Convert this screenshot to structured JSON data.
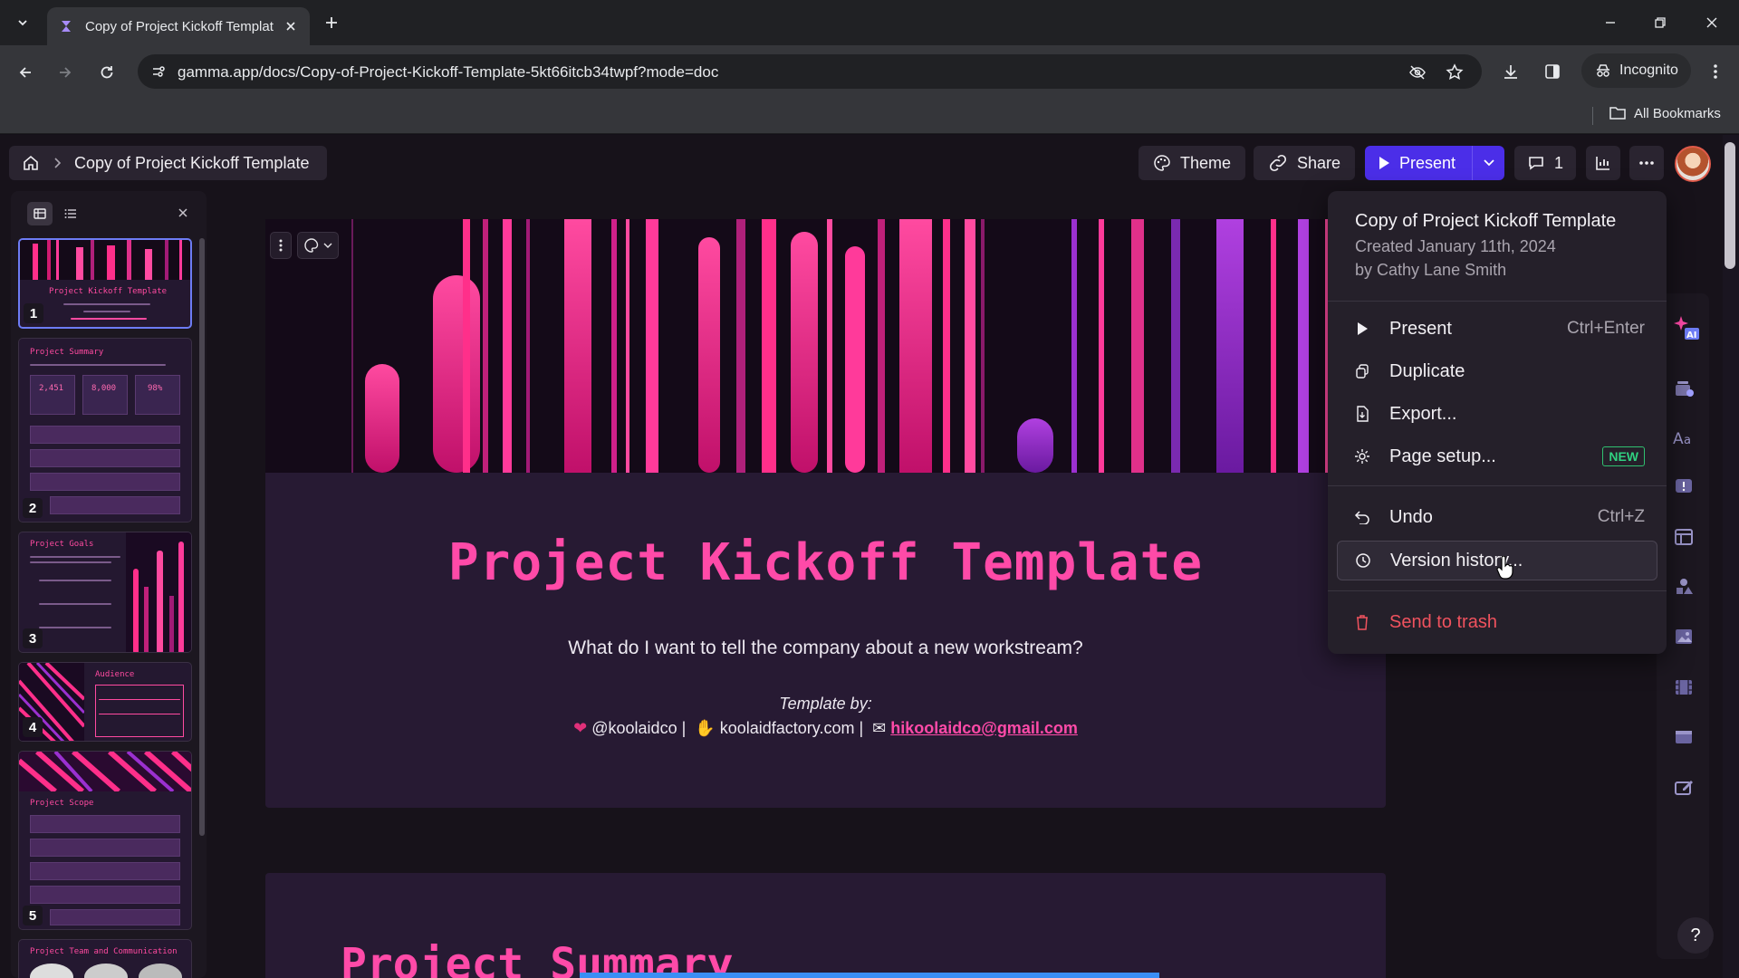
{
  "browser": {
    "tab_title": "Copy of Project Kickoff Templat",
    "url": "gamma.app/docs/Copy-of-Project-Kickoff-Template-5kt66itcb34twpf?mode=doc",
    "incognito_label": "Incognito",
    "bookmarks_label": "All Bookmarks"
  },
  "header": {
    "breadcrumb_title": "Copy of Project Kickoff Template",
    "theme_label": "Theme",
    "share_label": "Share",
    "present_label": "Present",
    "comments_count": "1"
  },
  "sidebar": {
    "thumbnails": [
      {
        "num": "1",
        "title": "Project Kickoff Template"
      },
      {
        "num": "2",
        "title": "Project Summary",
        "stats": [
          "2,451",
          "8,000",
          "98%"
        ]
      },
      {
        "num": "3",
        "title": "Project Goals"
      },
      {
        "num": "4",
        "title": "Audience"
      },
      {
        "num": "5",
        "title": "Project Scope"
      },
      {
        "num": "",
        "title": "Project Team and Communication"
      }
    ]
  },
  "doc": {
    "title": "Project Kickoff Template",
    "subtitle": "What do I want to tell the company about a new workstream?",
    "template_by": "Template by:",
    "handle": "@koolaidco |",
    "site": "koolaidfactory.com |",
    "email": "hikoolaidco@gmail.com",
    "next_title": "Project Summary"
  },
  "menu": {
    "title": "Copy of Project Kickoff Template",
    "created": "Created January 11th, 2024",
    "by": "by Cathy Lane Smith",
    "items": [
      {
        "label": "Present",
        "shortcut": "Ctrl+Enter",
        "icon": "play-icon"
      },
      {
        "label": "Duplicate",
        "shortcut": "",
        "icon": "duplicate-icon"
      },
      {
        "label": "Export...",
        "shortcut": "",
        "icon": "export-icon"
      },
      {
        "label": "Page setup...",
        "badge": "NEW",
        "icon": "gear-icon"
      },
      {
        "label": "Undo",
        "shortcut": "Ctrl+Z",
        "icon": "undo-icon"
      },
      {
        "label": "Version history...",
        "shortcut": "",
        "icon": "clock-icon"
      },
      {
        "label": "Send to trash",
        "shortcut": "",
        "icon": "trash-icon"
      }
    ]
  },
  "colors": {
    "accent": "#ff4aa8",
    "present_button": "#4b2ee8",
    "danger": "#f0525e",
    "new_badge": "#30d080"
  }
}
